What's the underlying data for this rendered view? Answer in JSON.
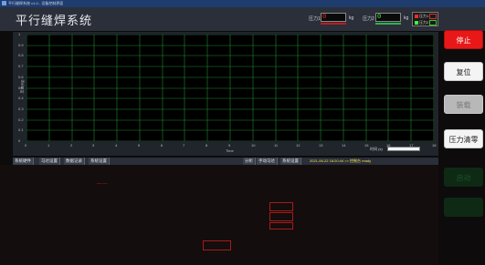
{
  "window": {
    "title": "平行缝焊系统 v1.0 - 设备控制界面"
  },
  "header": {
    "app_title": "平行缝焊系统"
  },
  "pressure1": {
    "label": "压力1",
    "value": "0",
    "unit": "kg",
    "value_color": "#ff2a2a",
    "bar_color": "#c21a1a"
  },
  "pressure2": {
    "label": "压力2",
    "value": "0",
    "unit": "kg",
    "value_color": "#3cff3c",
    "bar_color": "#2bb54a"
  },
  "legend": {
    "items": [
      {
        "label": "压力1",
        "color": "#ff2a2a"
      },
      {
        "label": "压力2",
        "color": "#3cff3c"
      }
    ]
  },
  "chart_data": {
    "type": "line",
    "title": "",
    "xlabel": "Time",
    "ylabel": "压力(kg)",
    "xlim": [
      0,
      18
    ],
    "ylim": [
      0,
      1
    ],
    "x_ticks": [
      "0",
      "1",
      "2",
      "3",
      "4",
      "5",
      "6",
      "7",
      "8",
      "9",
      "10",
      "11",
      "12",
      "13",
      "14",
      "15",
      "16",
      "17",
      "18"
    ],
    "y_ticks": [
      "1",
      "0.9",
      "0.8",
      "0.7",
      "0.6",
      "0.5",
      "0.4",
      "0.3",
      "0.2",
      "0.1",
      "0"
    ],
    "grid": true,
    "grid_color": "#1f8a2f",
    "series": []
  },
  "x_range_label": "时间 (s)",
  "side_buttons": [
    {
      "label": "停止",
      "style": "stop"
    },
    {
      "label": "复位",
      "style": "normal"
    },
    {
      "label": "装载",
      "style": "disabled"
    },
    {
      "label": "压力清零",
      "style": "normal"
    },
    {
      "label": "启动",
      "style": "dim"
    },
    {
      "label": "",
      "style": "dim"
    }
  ],
  "status_tabs_left": [
    "系统硬件",
    "马达设置",
    "数据记录",
    "系统设置"
  ],
  "status_tabs_right": [
    "分析",
    "手动马达",
    "系统设置"
  ],
  "status_text": "2021-06-22 18:20:44  >>  控制台 ready",
  "canvas_marker": "—·—"
}
